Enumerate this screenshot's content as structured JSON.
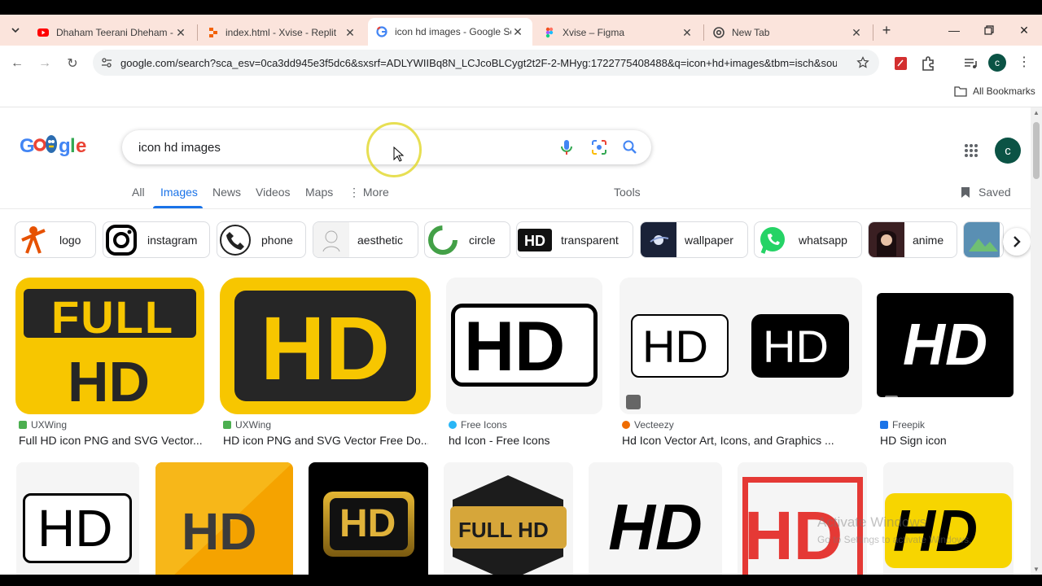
{
  "tabs": [
    {
      "title": "Dhaham Teerani Dheham - ",
      "icon": "youtube-icon"
    },
    {
      "title": "index.html - Xvise - Replit",
      "icon": "replit-icon"
    },
    {
      "title": "icon hd images - Google Se",
      "icon": "google-icon"
    },
    {
      "title": "Xvise – Figma",
      "icon": "figma-icon"
    },
    {
      "title": "New Tab",
      "icon": "chrome-icon"
    }
  ],
  "address": {
    "url": "google.com/search?sca_esv=0ca3dd945e3f5dc6&sxsrf=ADLYWIIBq8N_LCJcoBLCygt2t2F-2-MHyg:1722775408488&q=icon+hd+images&tbm=isch&sou..."
  },
  "bookmarks": {
    "all_label": "All Bookmarks"
  },
  "account_initial": "c",
  "search": {
    "query": "icon hd images"
  },
  "nav": {
    "all": "All",
    "images": "Images",
    "news": "News",
    "videos": "Videos",
    "maps": "Maps",
    "more": "More",
    "tools": "Tools",
    "saved": "Saved"
  },
  "chips": [
    "logo",
    "instagram",
    "phone",
    "aesthetic",
    "circle",
    "transparent",
    "wallpaper",
    "whatsapp",
    "anime"
  ],
  "results_row1": [
    {
      "source": "UXWing",
      "caption": "Full HD icon PNG and SVG Vector..."
    },
    {
      "source": "UXWing",
      "caption": "HD icon PNG and SVG Vector Free Do..."
    },
    {
      "source": "Free Icons",
      "caption": "hd Icon - Free Icons"
    },
    {
      "source": "Vecteezy",
      "caption": "Hd Icon Vector Art, Icons, and Graphics ..."
    },
    {
      "source": "Freepik",
      "caption": "HD Sign icon"
    }
  ],
  "image_text": {
    "full": "FULL",
    "hd": "HD",
    "full_hd": "FULL HD"
  },
  "watermark": {
    "line1": "Activate Windows",
    "line2": "Go to Settings to activate Windows."
  },
  "colors": {
    "accent": "#1a73e8",
    "tabstrip": "#fbe4dc",
    "yellow": "#f7c600",
    "account": "#0b5345"
  }
}
